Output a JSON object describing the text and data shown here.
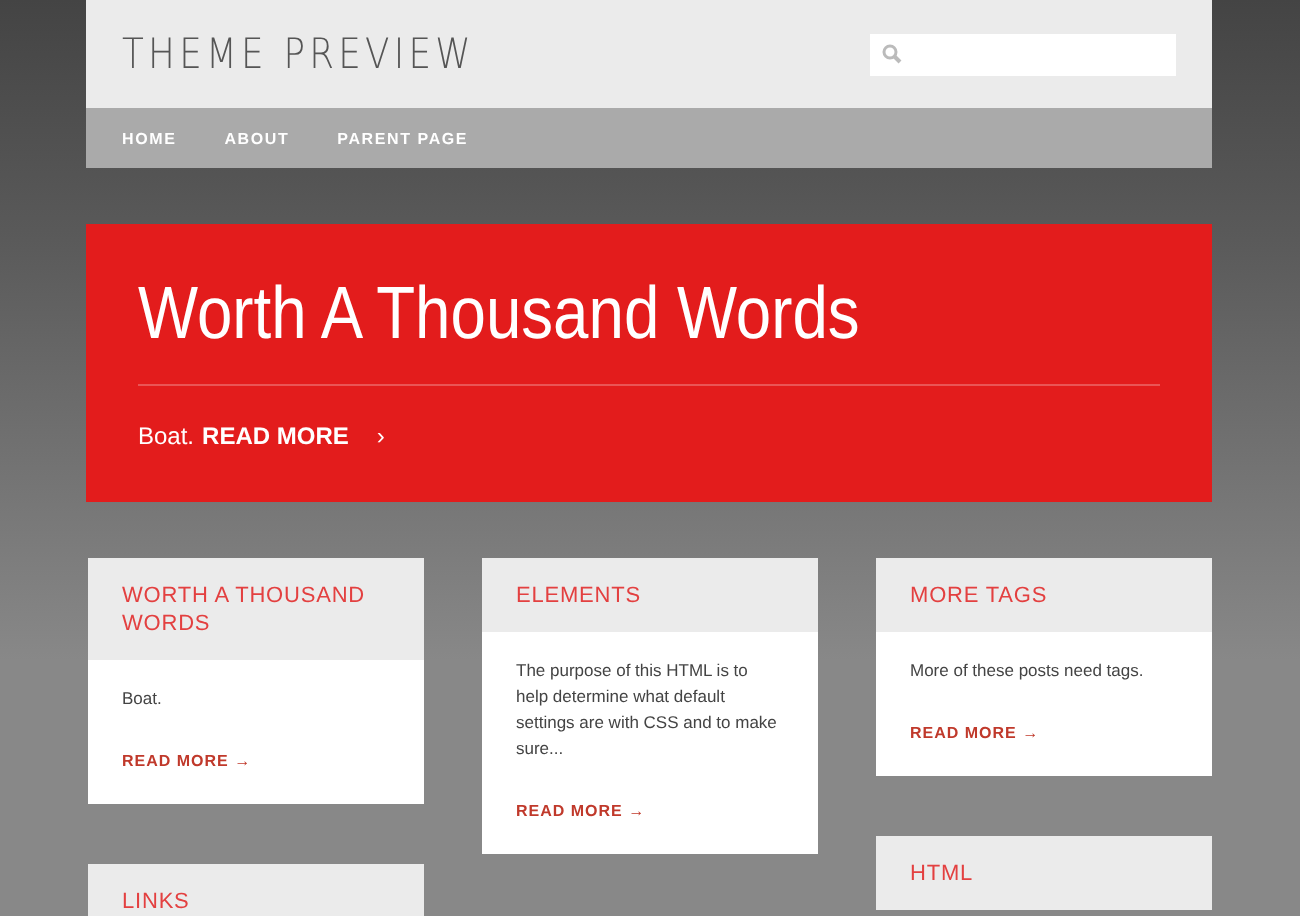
{
  "header": {
    "site_title": "THEME PREVIEW"
  },
  "nav": {
    "items": [
      {
        "label": "HOME"
      },
      {
        "label": "ABOUT"
      },
      {
        "label": "PARENT PAGE"
      }
    ]
  },
  "hero": {
    "title": "Worth A Thousand Words",
    "excerpt": "Boat.",
    "link": "READ MORE",
    "link_arrow": "›"
  },
  "columns": [
    {
      "cards": [
        {
          "title": "WORTH A THOUSAND WORDS",
          "excerpt": "Boat.",
          "link": "READ MORE →"
        },
        {
          "title": "LINKS"
        }
      ]
    },
    {
      "cards": [
        {
          "title": "ELEMENTS",
          "excerpt": "The purpose of this HTML is to help determine what default settings are with CSS and to make sure...",
          "link": "READ MORE →"
        }
      ]
    },
    {
      "cards": [
        {
          "title": "MORE TAGS",
          "excerpt": "More of these posts need tags.",
          "link": "READ MORE →"
        },
        {
          "title": "HTML"
        }
      ]
    }
  ]
}
